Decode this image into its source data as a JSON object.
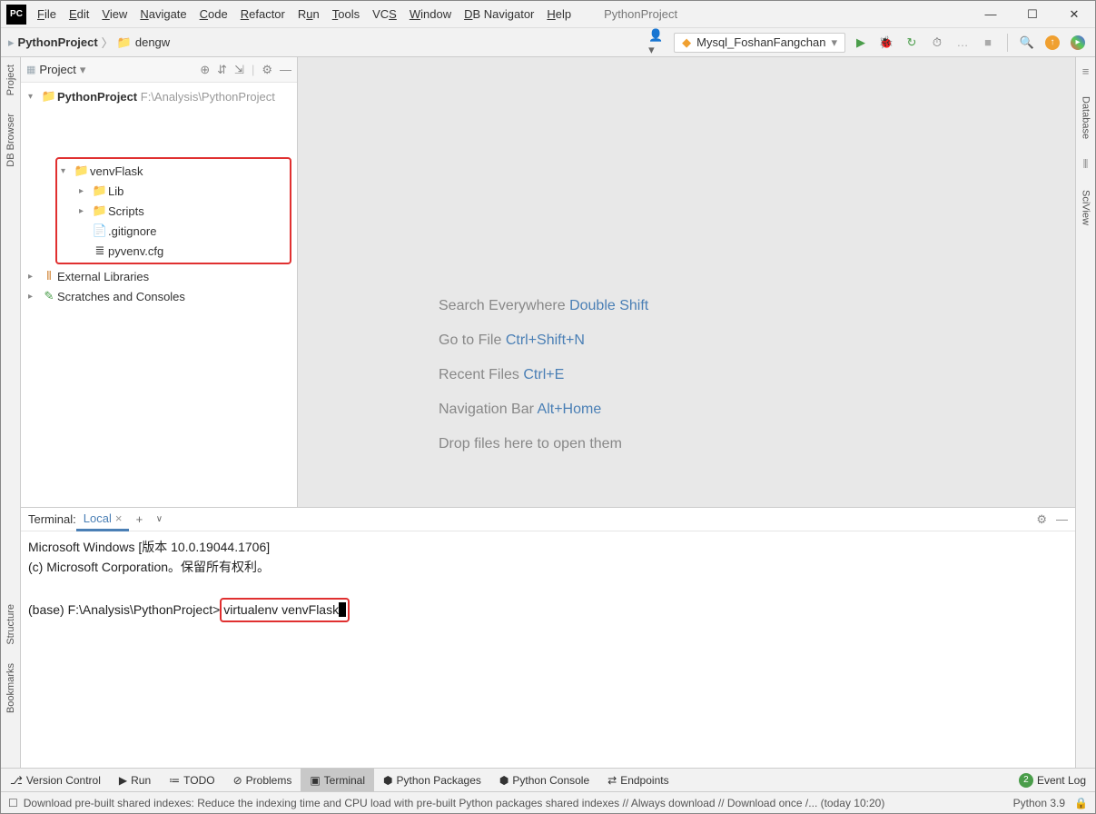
{
  "app_title": "PythonProject",
  "menus": [
    "File",
    "Edit",
    "View",
    "Navigate",
    "Code",
    "Refactor",
    "Run",
    "Tools",
    "VCS",
    "Window",
    "DB Navigator",
    "Help"
  ],
  "breadcrumb": {
    "project": "PythonProject",
    "folder": "dengw"
  },
  "run_config": "Mysql_FoshanFangchan",
  "left_tabs": [
    "Project",
    "DB Browser"
  ],
  "right_tabs": [
    "Database",
    "SciView"
  ],
  "project_panel": {
    "title": "Project",
    "root": {
      "name": "PythonProject",
      "path": "F:\\Analysis\\PythonProject"
    },
    "venv": {
      "name": "venvFlask",
      "children": [
        {
          "name": "Lib",
          "type": "folder"
        },
        {
          "name": "Scripts",
          "type": "folder"
        },
        {
          "name": ".gitignore",
          "type": "file"
        },
        {
          "name": "pyvenv.cfg",
          "type": "file"
        }
      ]
    },
    "external": "External Libraries",
    "scratches": "Scratches and Consoles"
  },
  "hints": [
    {
      "label": "Search Everywhere",
      "kbd": "Double Shift"
    },
    {
      "label": "Go to File",
      "kbd": "Ctrl+Shift+N"
    },
    {
      "label": "Recent Files",
      "kbd": "Ctrl+E"
    },
    {
      "label": "Navigation Bar",
      "kbd": "Alt+Home"
    },
    {
      "label": "Drop files here to open them",
      "kbd": ""
    }
  ],
  "terminal": {
    "title": "Terminal:",
    "tab": "Local",
    "line1": "Microsoft Windows [版本 10.0.19044.1706]",
    "line2": "(c) Microsoft Corporation。保留所有权利。",
    "prompt": "(base) F:\\Analysis\\PythonProject>",
    "cmd": "virtualenv venvFlask"
  },
  "bottom_tools": [
    "Version Control",
    "Run",
    "TODO",
    "Problems",
    "Terminal",
    "Python Packages",
    "Python Console",
    "Endpoints"
  ],
  "event_log": "Event Log",
  "status_msg": "Download pre-built shared indexes: Reduce the indexing time and CPU load with pre-built Python packages shared indexes // Always download // Download once /... (today 10:20)",
  "python_ver": "Python 3.9",
  "left_extra": [
    "Structure",
    "Bookmarks"
  ]
}
